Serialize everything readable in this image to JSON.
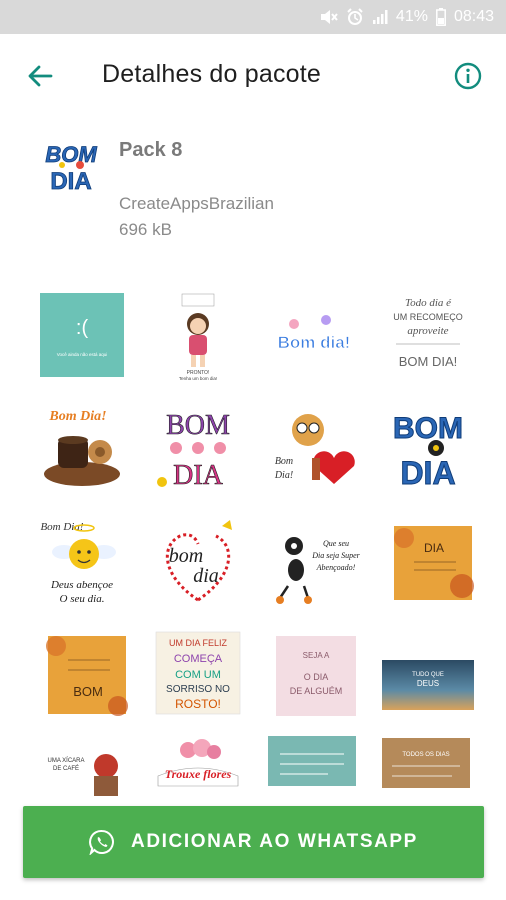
{
  "status_bar": {
    "battery": "41%",
    "time": "08:43",
    "icons": [
      "mute-icon",
      "alarm-icon",
      "signal-icon",
      "battery-icon"
    ]
  },
  "app_bar": {
    "title": "Detalhes do pacote",
    "back_icon": "arrow-back-icon",
    "info_icon": "info-icon"
  },
  "pack": {
    "icon_text": [
      "BOM",
      "DIA"
    ],
    "name": "Pack 8",
    "author": "CreateAppsBrazilian",
    "size": "696 kB"
  },
  "stickers": [
    {
      "name": "sticker-sad-face",
      "texts": [
        ":(",
        "Você ainda não está aqui"
      ]
    },
    {
      "name": "sticker-girl-pronto",
      "texts": [
        "PRONTO!",
        "Tenha um bom dia!"
      ]
    },
    {
      "name": "sticker-bom-dia-paws",
      "texts": [
        "Bom dia!"
      ]
    },
    {
      "name": "sticker-todo-dia",
      "texts": [
        "Todo dia é",
        "UM RECOMEÇO",
        "aproveite",
        "BOM DIA!"
      ]
    },
    {
      "name": "sticker-bom-dia-coffee",
      "texts": [
        "Bom Dia!"
      ]
    },
    {
      "name": "sticker-bom-dia-flowers",
      "texts": [
        "BOM",
        "DIA"
      ]
    },
    {
      "name": "sticker-bom-dia-dog",
      "texts": [
        "Bom",
        "Dia!"
      ]
    },
    {
      "name": "sticker-bom-dia-ant",
      "texts": [
        "BOM",
        "DIA"
      ]
    },
    {
      "name": "sticker-angel-emoji",
      "texts": [
        "Bom Dia!",
        "Deus abençoe",
        "O seu dia."
      ]
    },
    {
      "name": "sticker-bom-dia-heart",
      "texts": [
        "bom",
        "dia"
      ]
    },
    {
      "name": "sticker-ant-abencoado",
      "texts": [
        "Que seu",
        "Dia seja Super",
        "Abençoado!"
      ]
    },
    {
      "name": "sticker-autumn-dia",
      "texts": [
        "DIA"
      ]
    },
    {
      "name": "sticker-autumn-bom",
      "texts": [
        "BOM"
      ]
    },
    {
      "name": "sticker-um-dia-feliz",
      "texts": [
        "UM DIA FELIZ",
        "COMEÇA",
        "COM UM",
        "SORRISO NO",
        "ROSTO!"
      ]
    },
    {
      "name": "sticker-pink-quote",
      "texts": [
        "SEJA A",
        "O DIA",
        "DE ALGUÉM"
      ]
    },
    {
      "name": "sticker-sunset",
      "texts": [
        "TUDO QUE",
        "DEUS"
      ]
    },
    {
      "name": "sticker-coffee-quote",
      "texts": [
        "UMA XÍCARA",
        "DE CAFÉ"
      ]
    },
    {
      "name": "sticker-trouxe-flores",
      "texts": [
        "Trouxe flores"
      ]
    },
    {
      "name": "sticker-teal-quote",
      "texts": []
    },
    {
      "name": "sticker-wood-quote",
      "texts": [
        "TODOS OS DIAS"
      ]
    }
  ],
  "add_button": {
    "label": "ADICIONAR AO WHATSAPP",
    "icon": "whatsapp-icon"
  },
  "colors": {
    "accent": "#128c7e",
    "button": "#4caf50",
    "status_bar": "#d9d9d9"
  }
}
